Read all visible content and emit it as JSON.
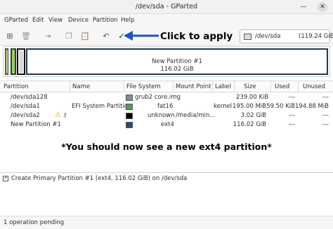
{
  "window": {
    "title": "/dev/sda - GParted",
    "minimize_icon": "minimize-icon",
    "close_icon": "close-icon"
  },
  "menubar": {
    "items": [
      "GParted",
      "Edit",
      "View",
      "Device",
      "Partition",
      "Help"
    ]
  },
  "toolbar": {
    "icons": [
      "new-partition-icon",
      "delete-icon",
      "resize-move-icon",
      "copy-icon",
      "paste-icon",
      "undo-icon",
      "apply-check-icon"
    ],
    "annotation": "Click to apply",
    "annotation_color": "#1a56c4"
  },
  "device_selector": {
    "device": "/dev/sda",
    "size": "(119.24 GiE"
  },
  "disk_map": {
    "partition_name": "New Partition #1",
    "partition_size": "116.02 GiB",
    "colors": {
      "bios": "#7e7e7e",
      "efi": "#9ad36a",
      "swap": "#111111",
      "ext4": "#1f3950"
    }
  },
  "table": {
    "columns": [
      "Partition",
      "Name",
      "File System",
      "Mount Point",
      "Label",
      "Size",
      "Used",
      "Unused"
    ],
    "rows": [
      {
        "partition": "/dev/sda128",
        "name": "",
        "fs": "grub2 core.img",
        "fs_color": "#8a8a8a",
        "mount": "",
        "label": "",
        "size": "239.00 KiB",
        "used": "---",
        "unused": "---",
        "key": true,
        "warn": false
      },
      {
        "partition": "/dev/sda1",
        "name": "EFI System Partition",
        "fs": "fat16",
        "fs_color": "#4aa24a",
        "mount": "",
        "label": "kernel",
        "size": "195.00 MiB",
        "used": "59.50 KiB",
        "unused": "194.88 MiB",
        "key": false,
        "warn": false
      },
      {
        "partition": "/dev/sda2",
        "name": "",
        "fs": "unknown",
        "fs_color": "#000000",
        "mount": "/media/min...",
        "label": "",
        "size": "3.02 GiB",
        "used": "---",
        "unused": "---",
        "key": true,
        "warn": true
      },
      {
        "partition": "New Partition #1",
        "name": "",
        "fs": "ext4",
        "fs_color": "#2a4a66",
        "mount": "",
        "label": "",
        "size": "116.02 GiB",
        "used": "---",
        "unused": "---",
        "key": false,
        "warn": false
      }
    ]
  },
  "annotation_note": "*You should now see a new ext4 partition*",
  "pending_ops": [
    "Create Primary Partition #1 (ext4, 116.02 GiB) on /dev/sda"
  ],
  "status": "1 operation pending"
}
